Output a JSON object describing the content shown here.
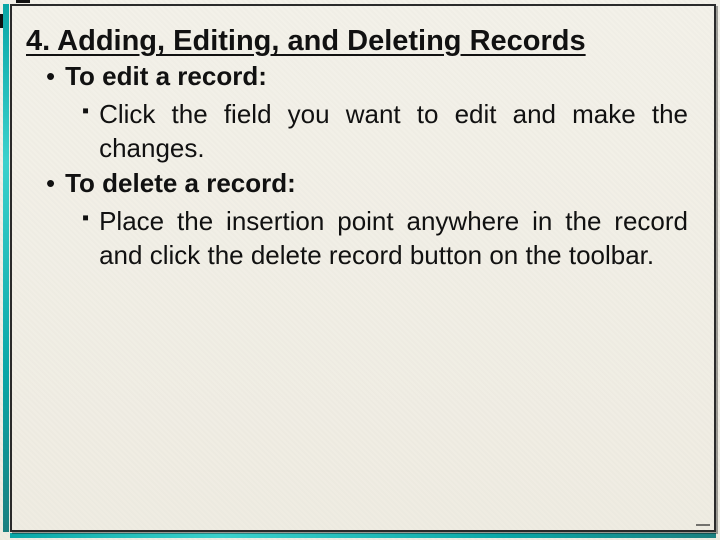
{
  "title": "4. Adding, Editing, and Deleting Records",
  "bullets": [
    {
      "label": "To edit a record:",
      "sub": "Click the field you want to edit and make the changes."
    },
    {
      "label": "To delete a record:",
      "sub": "Place the insertion point anywhere in the record and click the delete record button on the toolbar."
    }
  ]
}
